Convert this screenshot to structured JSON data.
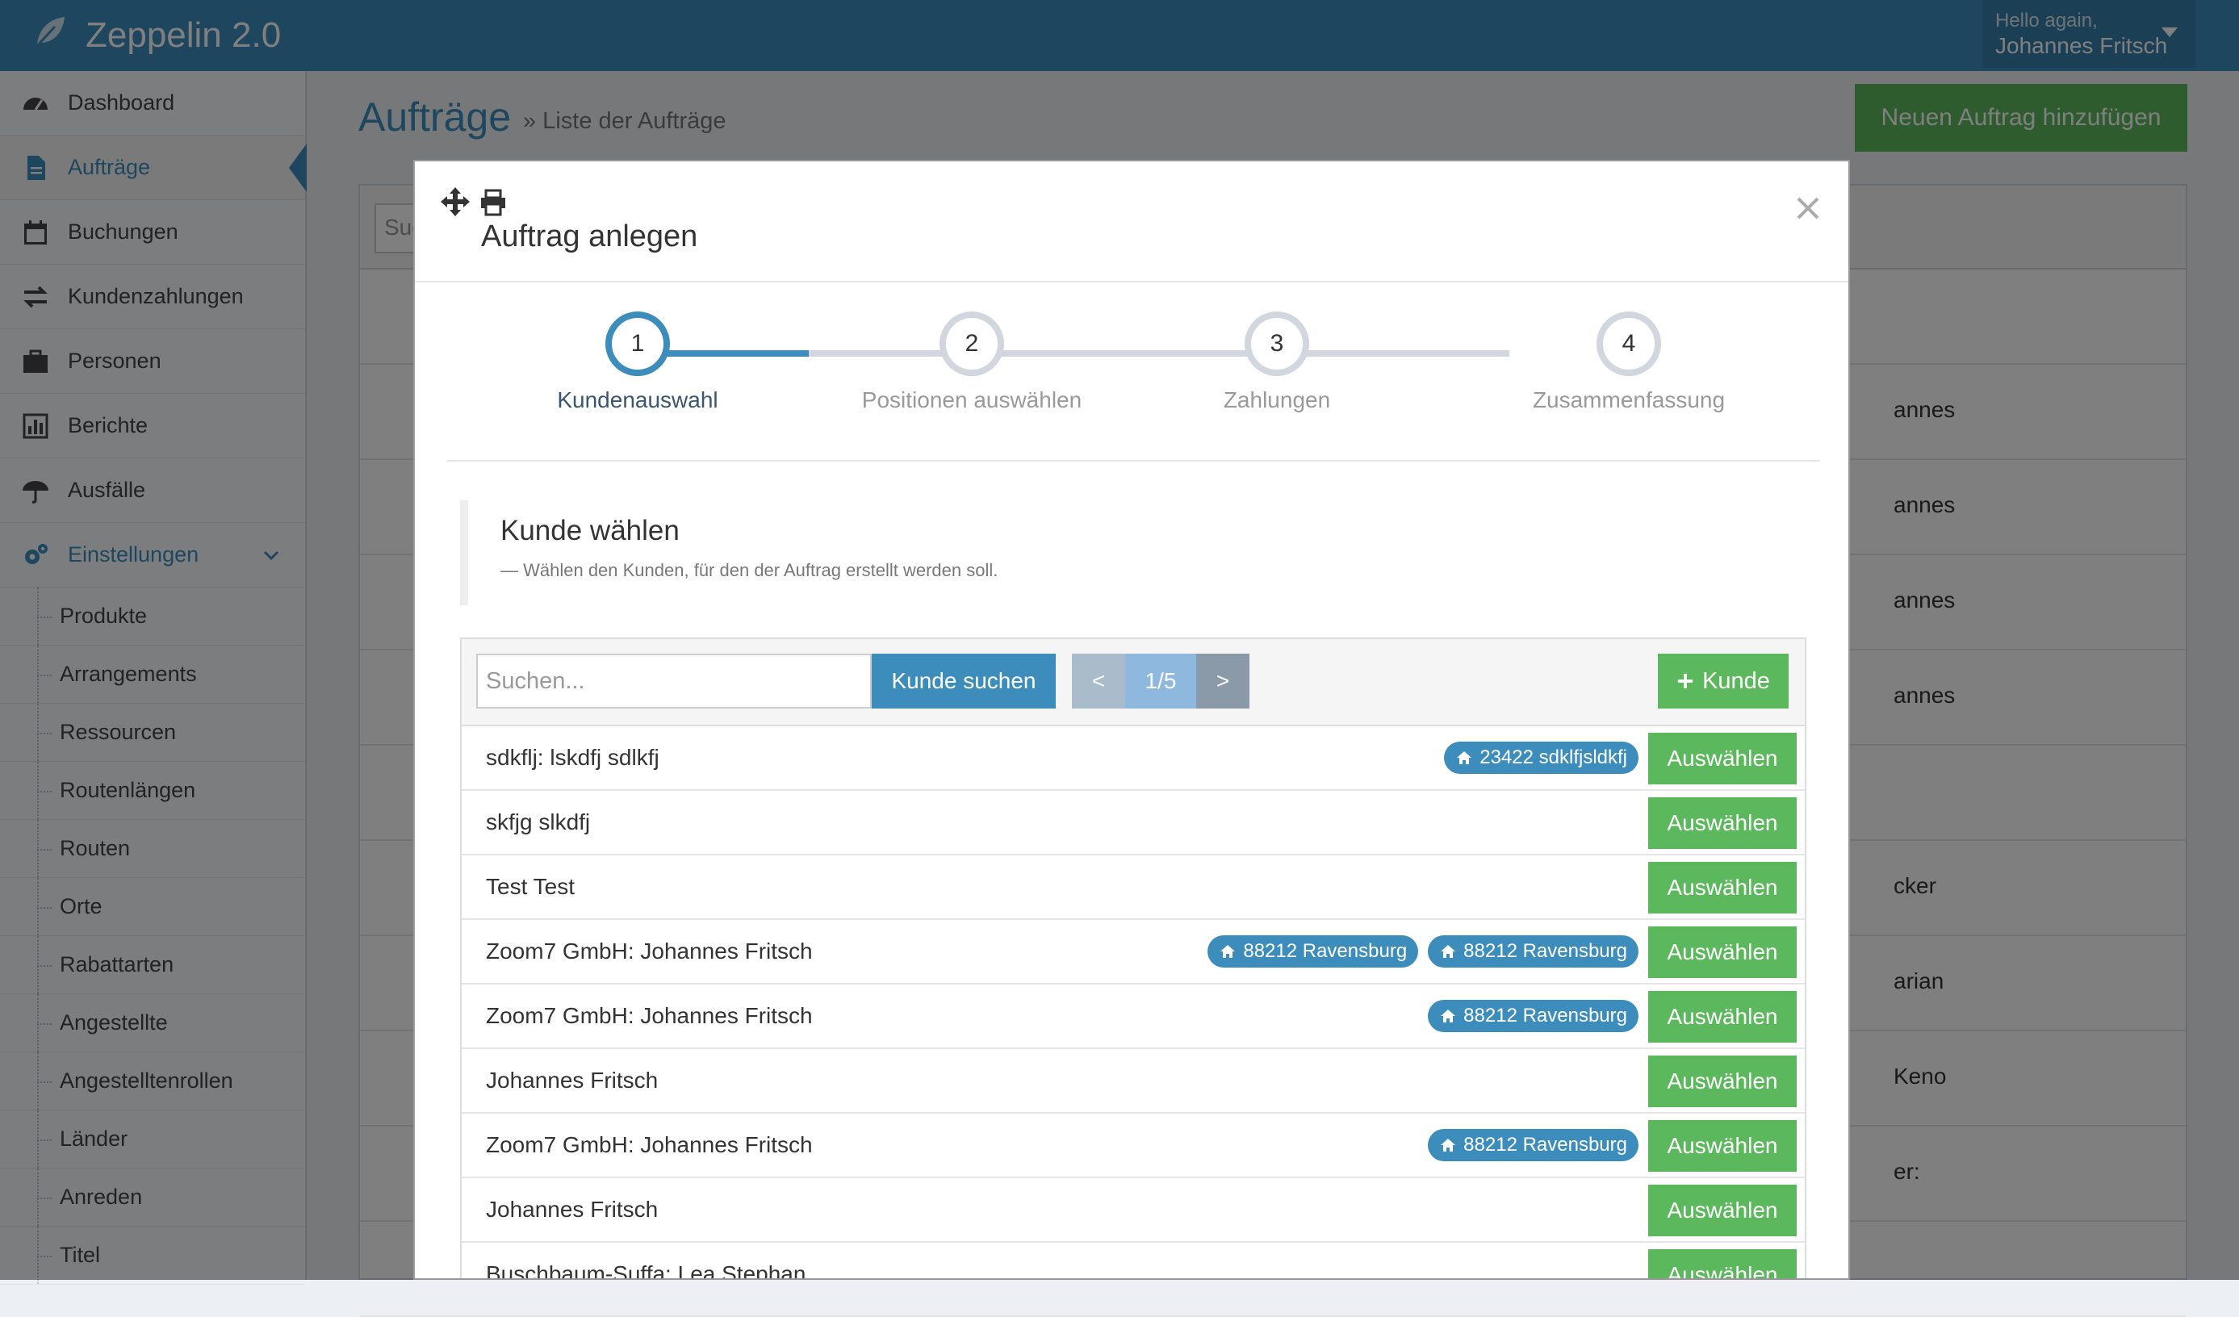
{
  "app": {
    "title": "Zeppelin 2.0"
  },
  "user": {
    "greeting": "Hello again,",
    "name": "Johannes Fritsch"
  },
  "sidebar": {
    "items": [
      {
        "label": "Dashboard",
        "icon": "dashboard-icon"
      },
      {
        "label": "Aufträge",
        "icon": "file-icon"
      },
      {
        "label": "Buchungen",
        "icon": "calendar-icon"
      },
      {
        "label": "Kundenzahlungen",
        "icon": "exchange-icon"
      },
      {
        "label": "Personen",
        "icon": "briefcase-icon"
      },
      {
        "label": "Berichte",
        "icon": "bar-chart-icon"
      },
      {
        "label": "Ausfälle",
        "icon": "umbrella-icon"
      },
      {
        "label": "Einstellungen",
        "icon": "gears-icon"
      }
    ],
    "subitems": [
      "Produkte",
      "Arrangements",
      "Ressourcen",
      "Routenlängen",
      "Routen",
      "Orte",
      "Rabattarten",
      "Angestellte",
      "Angestelltenrollen",
      "Länder",
      "Anreden",
      "Titel"
    ]
  },
  "page": {
    "title": "Aufträge",
    "subtitle": "» Liste der Aufträge",
    "add_button": "Neuen Auftrag hinzufügen",
    "bg_search": "Suc",
    "bg_names": [
      "",
      "annes",
      "annes",
      "annes",
      "annes",
      "",
      "cker",
      "arian",
      "Keno",
      "er:",
      ""
    ]
  },
  "modal": {
    "title": "Auftrag anlegen",
    "steps": [
      {
        "num": "1",
        "label": "Kundenauswahl"
      },
      {
        "num": "2",
        "label": "Positionen auswählen"
      },
      {
        "num": "3",
        "label": "Zahlungen"
      },
      {
        "num": "4",
        "label": "Zusammenfassung"
      }
    ],
    "section_title": "Kunde wählen",
    "section_hint": "— Wählen den Kunden, für den der Auftrag erstellt werden soll.",
    "search_placeholder": "Suchen...",
    "search_button": "Kunde suchen",
    "pager": {
      "prev": "<",
      "current": "1/5",
      "next": ">"
    },
    "add_customer": "Kunde",
    "select_label": "Auswählen",
    "customers": [
      {
        "name": "sdkflj: lskdfj sdlkfj",
        "badges": [
          "23422 sdklfjsldkfj"
        ]
      },
      {
        "name": "skfjg slkdfj",
        "badges": []
      },
      {
        "name": "Test Test",
        "badges": []
      },
      {
        "name": "Zoom7 GmbH: Johannes Fritsch",
        "badges": [
          "88212 Ravensburg",
          "88212 Ravensburg"
        ]
      },
      {
        "name": "Zoom7 GmbH: Johannes Fritsch",
        "badges": [
          "88212 Ravensburg"
        ]
      },
      {
        "name": "Johannes Fritsch",
        "badges": []
      },
      {
        "name": "Zoom7 GmbH: Johannes Fritsch",
        "badges": [
          "88212 Ravensburg"
        ]
      },
      {
        "name": "Johannes Fritsch",
        "badges": []
      },
      {
        "name": "Buschbaum-Suffa: Lea Stephan",
        "badges": []
      }
    ]
  },
  "colors": {
    "primary": "#3c8dbc",
    "success": "#5cb85c",
    "sidebar_bg": "#f9fafc"
  }
}
